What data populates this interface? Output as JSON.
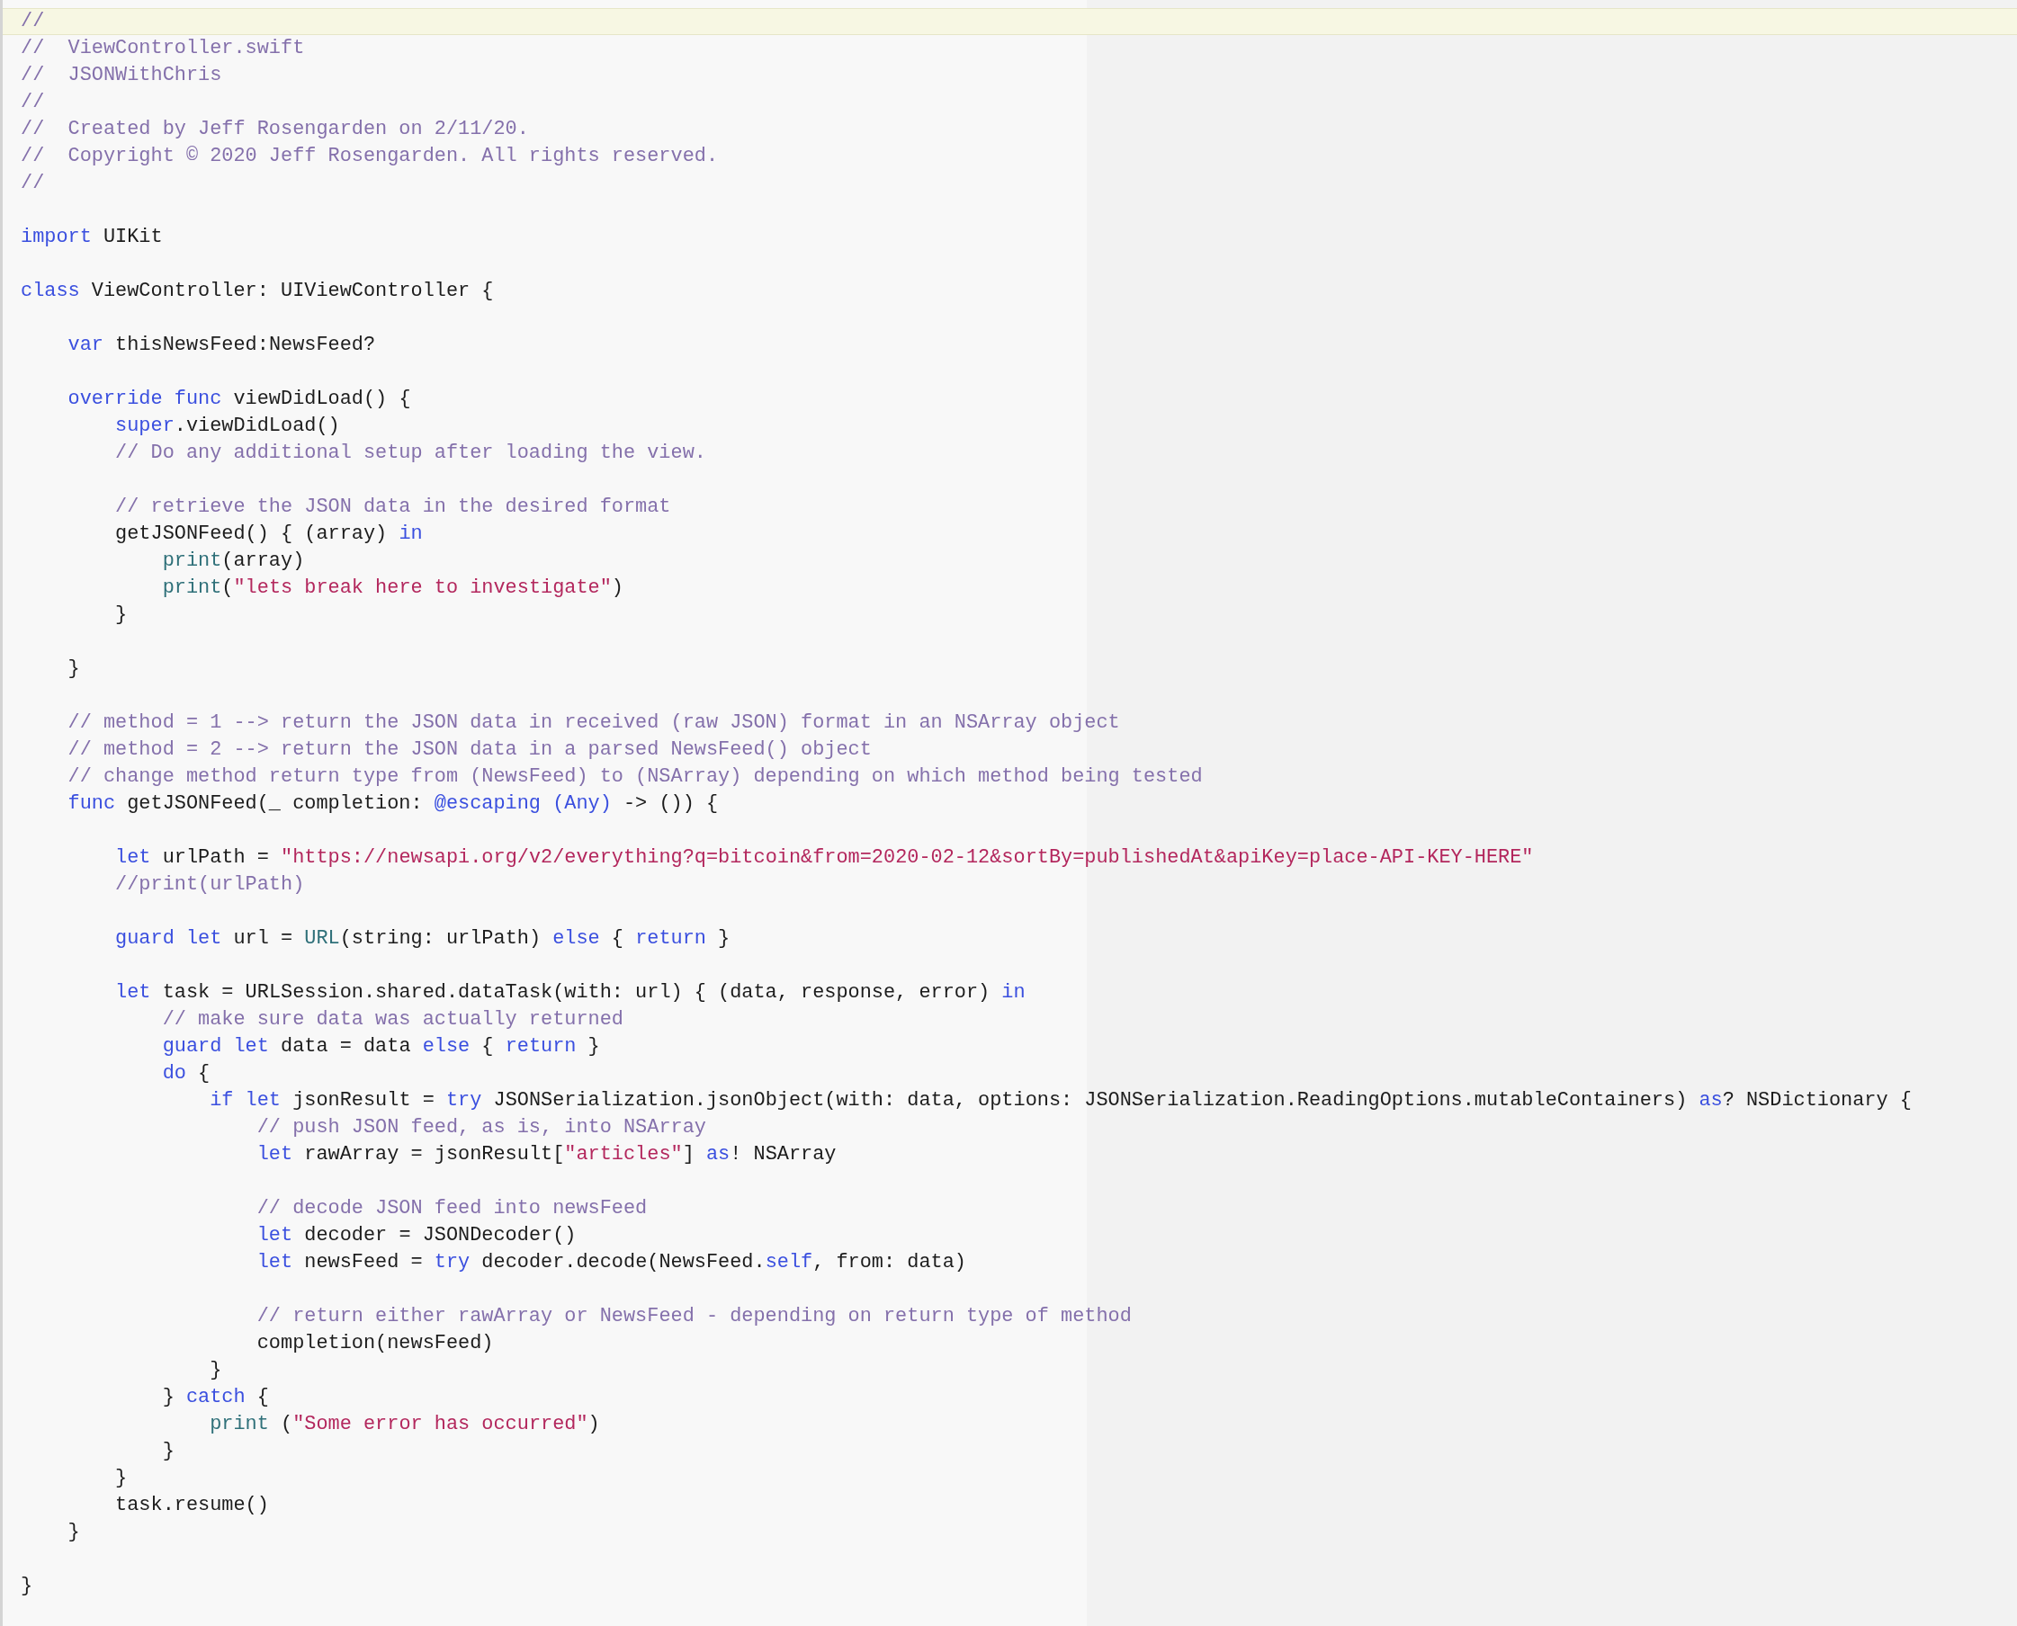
{
  "editor": {
    "lines": [
      {
        "kind": "code",
        "current": true,
        "tokens": [
          {
            "kind": "comment",
            "text": "//"
          }
        ]
      },
      {
        "kind": "code",
        "current": false,
        "tokens": [
          {
            "kind": "comment",
            "text": "//  ViewController.swift"
          }
        ]
      },
      {
        "kind": "code",
        "current": false,
        "tokens": [
          {
            "kind": "comment",
            "text": "//  JSONWithChris"
          }
        ]
      },
      {
        "kind": "code",
        "current": false,
        "tokens": [
          {
            "kind": "comment",
            "text": "//"
          }
        ]
      },
      {
        "kind": "code",
        "current": false,
        "tokens": [
          {
            "kind": "comment",
            "text": "//  Created by Jeff Rosengarden on 2/11/20."
          }
        ]
      },
      {
        "kind": "code",
        "current": false,
        "tokens": [
          {
            "kind": "comment",
            "text": "//  Copyright © 2020 Jeff Rosengarden. All rights reserved."
          }
        ]
      },
      {
        "kind": "code",
        "current": false,
        "tokens": [
          {
            "kind": "comment",
            "text": "//"
          }
        ]
      },
      {
        "kind": "blank",
        "current": false
      },
      {
        "kind": "code",
        "current": false,
        "tokens": [
          {
            "kind": "keyword",
            "text": "import"
          },
          {
            "kind": "plain",
            "text": " UIKit"
          }
        ]
      },
      {
        "kind": "blank",
        "current": false
      },
      {
        "kind": "code",
        "current": false,
        "tokens": [
          {
            "kind": "keyword",
            "text": "class"
          },
          {
            "kind": "plain",
            "text": " ViewController: UIViewController {"
          }
        ]
      },
      {
        "kind": "blank",
        "current": false
      },
      {
        "kind": "code",
        "current": false,
        "tokens": [
          {
            "kind": "keyword",
            "text": "    var"
          },
          {
            "kind": "plain",
            "text": " thisNewsFeed:NewsFeed?"
          }
        ]
      },
      {
        "kind": "blank",
        "current": false
      },
      {
        "kind": "code",
        "current": false,
        "tokens": [
          {
            "kind": "keyword",
            "text": "    override func"
          },
          {
            "kind": "plain",
            "text": " viewDidLoad() {"
          }
        ]
      },
      {
        "kind": "code",
        "current": false,
        "tokens": [
          {
            "kind": "keyword",
            "text": "        super"
          },
          {
            "kind": "plain",
            "text": ".viewDidLoad()"
          }
        ]
      },
      {
        "kind": "code",
        "current": false,
        "tokens": [
          {
            "kind": "comment",
            "text": "        // Do any additional setup after loading the view."
          }
        ]
      },
      {
        "kind": "blank",
        "current": false
      },
      {
        "kind": "code",
        "current": false,
        "tokens": [
          {
            "kind": "comment",
            "text": "        // retrieve the JSON data in the desired format"
          }
        ]
      },
      {
        "kind": "code",
        "current": false,
        "tokens": [
          {
            "kind": "plain",
            "text": "        getJSONFeed() { (array) "
          },
          {
            "kind": "keyword",
            "text": "in"
          }
        ]
      },
      {
        "kind": "code",
        "current": false,
        "tokens": [
          {
            "kind": "function",
            "text": "            print"
          },
          {
            "kind": "plain",
            "text": "(array)"
          }
        ]
      },
      {
        "kind": "code",
        "current": false,
        "tokens": [
          {
            "kind": "function",
            "text": "            print"
          },
          {
            "kind": "plain",
            "text": "("
          },
          {
            "kind": "string",
            "text": "\"lets break here to investigate\""
          },
          {
            "kind": "plain",
            "text": ")"
          }
        ]
      },
      {
        "kind": "code",
        "current": false,
        "tokens": [
          {
            "kind": "plain",
            "text": "        }"
          }
        ]
      },
      {
        "kind": "blank",
        "current": false
      },
      {
        "kind": "code",
        "current": false,
        "tokens": [
          {
            "kind": "plain",
            "text": "    }"
          }
        ]
      },
      {
        "kind": "blank",
        "current": false
      },
      {
        "kind": "code",
        "current": false,
        "tokens": [
          {
            "kind": "comment",
            "text": "    // method = 1 --> return the JSON data in received (raw JSON) format in an NSArray object"
          }
        ]
      },
      {
        "kind": "code",
        "current": false,
        "tokens": [
          {
            "kind": "comment",
            "text": "    // method = 2 --> return the JSON data in a parsed NewsFeed() object"
          }
        ]
      },
      {
        "kind": "code",
        "current": false,
        "tokens": [
          {
            "kind": "comment",
            "text": "    // change method return type from (NewsFeed) to (NSArray) depending on which method being tested"
          }
        ]
      },
      {
        "kind": "code",
        "current": false,
        "tokens": [
          {
            "kind": "keyword",
            "text": "    func"
          },
          {
            "kind": "plain",
            "text": " getJSONFeed(_ completion: "
          },
          {
            "kind": "keyword",
            "text": "@escaping (Any)"
          },
          {
            "kind": "plain",
            "text": " -> ()) {"
          }
        ]
      },
      {
        "kind": "blank",
        "current": false
      },
      {
        "kind": "code",
        "current": false,
        "tokens": [
          {
            "kind": "keyword",
            "text": "        let"
          },
          {
            "kind": "plain",
            "text": " urlPath = "
          },
          {
            "kind": "string",
            "text": "\"https://newsapi.org/v2/everything?q=bitcoin&from=2020-02-12&sortBy=publishedAt&apiKey=place-API-KEY-HERE\""
          }
        ]
      },
      {
        "kind": "code",
        "current": false,
        "tokens": [
          {
            "kind": "comment",
            "text": "        //print(urlPath)"
          }
        ]
      },
      {
        "kind": "blank",
        "current": false
      },
      {
        "kind": "code",
        "current": false,
        "tokens": [
          {
            "kind": "keyword",
            "text": "        guard let"
          },
          {
            "kind": "plain",
            "text": " url = "
          },
          {
            "kind": "function",
            "text": "URL"
          },
          {
            "kind": "plain",
            "text": "(string: urlPath) "
          },
          {
            "kind": "keyword",
            "text": "else"
          },
          {
            "kind": "plain",
            "text": " { "
          },
          {
            "kind": "keyword",
            "text": "return"
          },
          {
            "kind": "plain",
            "text": " }"
          }
        ]
      },
      {
        "kind": "blank",
        "current": false
      },
      {
        "kind": "code",
        "current": false,
        "tokens": [
          {
            "kind": "keyword",
            "text": "        let"
          },
          {
            "kind": "plain",
            "text": " task = URLSession.shared.dataTask(with: url) { (data, response, error) "
          },
          {
            "kind": "keyword",
            "text": "in"
          }
        ]
      },
      {
        "kind": "code",
        "current": false,
        "tokens": [
          {
            "kind": "comment",
            "text": "            // make sure data was actually returned"
          }
        ]
      },
      {
        "kind": "code",
        "current": false,
        "tokens": [
          {
            "kind": "keyword",
            "text": "            guard let"
          },
          {
            "kind": "plain",
            "text": " data = data "
          },
          {
            "kind": "keyword",
            "text": "else"
          },
          {
            "kind": "plain",
            "text": " { "
          },
          {
            "kind": "keyword",
            "text": "return"
          },
          {
            "kind": "plain",
            "text": " }"
          }
        ]
      },
      {
        "kind": "code",
        "current": false,
        "tokens": [
          {
            "kind": "keyword",
            "text": "            do"
          },
          {
            "kind": "plain",
            "text": " {"
          }
        ]
      },
      {
        "kind": "code",
        "current": false,
        "tokens": [
          {
            "kind": "keyword",
            "text": "                if let"
          },
          {
            "kind": "plain",
            "text": " jsonResult = "
          },
          {
            "kind": "keyword",
            "text": "try"
          },
          {
            "kind": "plain",
            "text": " JSONSerialization.jsonObject(with: data, options: JSONSerialization.ReadingOptions.mutableContainers) "
          },
          {
            "kind": "keyword",
            "text": "as"
          },
          {
            "kind": "plain",
            "text": "? NSDictionary {"
          }
        ]
      },
      {
        "kind": "code",
        "current": false,
        "tokens": [
          {
            "kind": "comment",
            "text": "                    // push JSON feed, as is, into NSArray"
          }
        ]
      },
      {
        "kind": "code",
        "current": false,
        "tokens": [
          {
            "kind": "keyword",
            "text": "                    let"
          },
          {
            "kind": "plain",
            "text": " rawArray = jsonResult["
          },
          {
            "kind": "string",
            "text": "\"articles\""
          },
          {
            "kind": "plain",
            "text": "] "
          },
          {
            "kind": "keyword",
            "text": "as"
          },
          {
            "kind": "plain",
            "text": "! NSArray"
          }
        ]
      },
      {
        "kind": "blank",
        "current": false
      },
      {
        "kind": "code",
        "current": false,
        "tokens": [
          {
            "kind": "comment",
            "text": "                    // decode JSON feed into newsFeed"
          }
        ]
      },
      {
        "kind": "code",
        "current": false,
        "tokens": [
          {
            "kind": "keyword",
            "text": "                    let"
          },
          {
            "kind": "plain",
            "text": " decoder = JSONDecoder()"
          }
        ]
      },
      {
        "kind": "code",
        "current": false,
        "tokens": [
          {
            "kind": "keyword",
            "text": "                    let"
          },
          {
            "kind": "plain",
            "text": " newsFeed = "
          },
          {
            "kind": "keyword",
            "text": "try"
          },
          {
            "kind": "plain",
            "text": " decoder.decode(NewsFeed."
          },
          {
            "kind": "keyword",
            "text": "self"
          },
          {
            "kind": "plain",
            "text": ", from: data)"
          }
        ]
      },
      {
        "kind": "blank",
        "current": false
      },
      {
        "kind": "code",
        "current": false,
        "tokens": [
          {
            "kind": "comment",
            "text": "                    // return either rawArray or NewsFeed - depending on return type of method"
          }
        ]
      },
      {
        "kind": "code",
        "current": false,
        "tokens": [
          {
            "kind": "plain",
            "text": "                    completion(newsFeed)"
          }
        ]
      },
      {
        "kind": "code",
        "current": false,
        "tokens": [
          {
            "kind": "plain",
            "text": "                }"
          }
        ]
      },
      {
        "kind": "code",
        "current": false,
        "tokens": [
          {
            "kind": "plain",
            "text": "            } "
          },
          {
            "kind": "keyword",
            "text": "catch"
          },
          {
            "kind": "plain",
            "text": " {"
          }
        ]
      },
      {
        "kind": "code",
        "current": false,
        "tokens": [
          {
            "kind": "function",
            "text": "                print"
          },
          {
            "kind": "plain",
            "text": " ("
          },
          {
            "kind": "string",
            "text": "\"Some error has occurred\""
          },
          {
            "kind": "plain",
            "text": ")"
          }
        ]
      },
      {
        "kind": "code",
        "current": false,
        "tokens": [
          {
            "kind": "plain",
            "text": "            }"
          }
        ]
      },
      {
        "kind": "code",
        "current": false,
        "tokens": [
          {
            "kind": "plain",
            "text": "        }"
          }
        ]
      },
      {
        "kind": "code",
        "current": false,
        "tokens": [
          {
            "kind": "plain",
            "text": "        task.resume()"
          }
        ]
      },
      {
        "kind": "code",
        "current": false,
        "tokens": [
          {
            "kind": "plain",
            "text": "    }"
          }
        ]
      },
      {
        "kind": "blank",
        "current": false
      },
      {
        "kind": "code",
        "current": false,
        "tokens": [
          {
            "kind": "plain",
            "text": "}"
          }
        ]
      }
    ]
  }
}
